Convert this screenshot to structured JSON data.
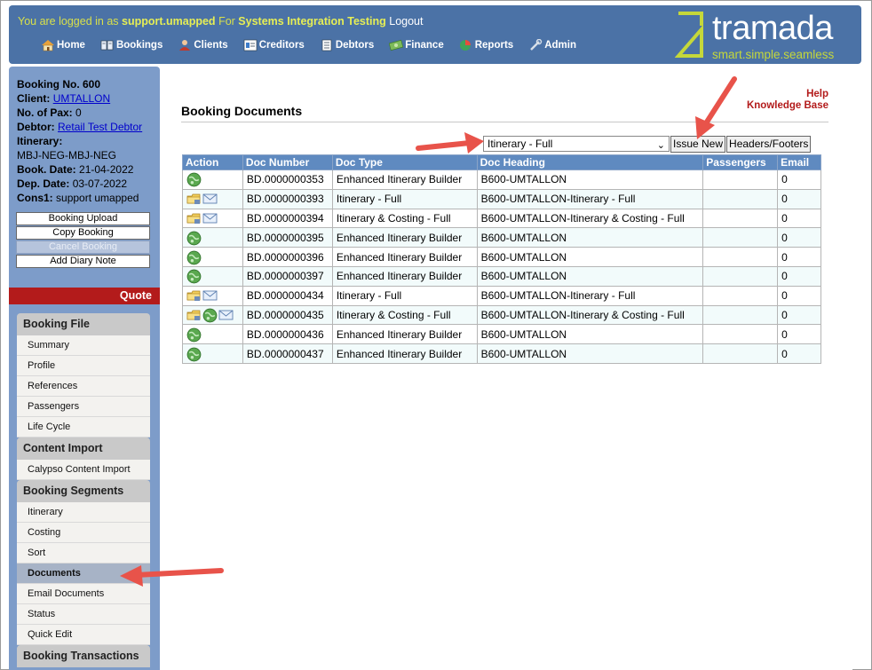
{
  "header": {
    "login_prefix": "You are logged in as",
    "username": "support.umapped",
    "for_text": "For",
    "system": "Systems Integration Testing",
    "logout": "Logout",
    "logo_name": "tramada",
    "logo_tagline": "smart.simple.seamless",
    "nav": [
      {
        "label": "Home",
        "icon": "home-icon"
      },
      {
        "label": "Bookings",
        "icon": "bookings-icon"
      },
      {
        "label": "Clients",
        "icon": "clients-icon"
      },
      {
        "label": "Creditors",
        "icon": "creditors-icon"
      },
      {
        "label": "Debtors",
        "icon": "debtors-icon"
      },
      {
        "label": "Finance",
        "icon": "finance-icon"
      },
      {
        "label": "Reports",
        "icon": "reports-icon"
      },
      {
        "label": "Admin",
        "icon": "admin-icon"
      }
    ]
  },
  "booking": {
    "number_label": "Booking No. 600",
    "client_label": "Client:",
    "client_value": "UMTALLON",
    "pax_label": "No. of Pax:",
    "pax_value": "0",
    "debtor_label": "Debtor:",
    "debtor_value": "Retail Test Debtor",
    "itinerary_label": "Itinerary:",
    "itinerary_value": "MBJ-NEG-MBJ-NEG",
    "book_date_label": "Book. Date:",
    "book_date_value": "21-04-2022",
    "dep_date_label": "Dep. Date:",
    "dep_date_value": "03-07-2022",
    "cons_label": "Cons1:",
    "cons_value": "support umapped"
  },
  "sidebar": {
    "buttons": {
      "upload": "Booking Upload",
      "copy": "Copy Booking",
      "cancel": "Cancel Booking",
      "diary": "Add Diary Note"
    },
    "quote": "Quote",
    "sections": {
      "file": "Booking File",
      "file_items": [
        "Summary",
        "Profile",
        "References",
        "Passengers",
        "Life Cycle"
      ],
      "content": "Content Import",
      "content_items": [
        "Calypso Content Import"
      ],
      "segments": "Booking Segments",
      "segment_items": [
        "Itinerary",
        "Costing",
        "Sort",
        "Documents",
        "Email Documents",
        "Status",
        "Quick Edit"
      ],
      "transactions": "Booking Transactions"
    }
  },
  "main": {
    "help": "Help",
    "kb": "Knowledge Base",
    "title": "Booking Documents",
    "select_value": "Itinerary - Full",
    "issue_new": "Issue New",
    "headers_footers": "Headers/Footers",
    "columns": [
      "Action",
      "Doc Number",
      "Doc Type",
      "Doc Heading",
      "Passengers",
      "Email"
    ],
    "rows": [
      {
        "icons": [
          "globe"
        ],
        "number": "BD.0000000353",
        "type": "Enhanced Itinerary Builder",
        "heading": "B600-UMTALLON",
        "passengers": "",
        "email": "0"
      },
      {
        "icons": [
          "folder",
          "mail"
        ],
        "number": "BD.0000000393",
        "type": "Itinerary - Full",
        "heading": "B600-UMTALLON-Itinerary - Full",
        "passengers": "",
        "email": "0"
      },
      {
        "icons": [
          "folder",
          "mail"
        ],
        "number": "BD.0000000394",
        "type": "Itinerary & Costing - Full",
        "heading": "B600-UMTALLON-Itinerary & Costing - Full",
        "passengers": "",
        "email": "0"
      },
      {
        "icons": [
          "globe"
        ],
        "number": "BD.0000000395",
        "type": "Enhanced Itinerary Builder",
        "heading": "B600-UMTALLON",
        "passengers": "",
        "email": "0"
      },
      {
        "icons": [
          "globe"
        ],
        "number": "BD.0000000396",
        "type": "Enhanced Itinerary Builder",
        "heading": "B600-UMTALLON",
        "passengers": "",
        "email": "0"
      },
      {
        "icons": [
          "globe"
        ],
        "number": "BD.0000000397",
        "type": "Enhanced Itinerary Builder",
        "heading": "B600-UMTALLON",
        "passengers": "",
        "email": "0"
      },
      {
        "icons": [
          "folder",
          "mail"
        ],
        "number": "BD.0000000434",
        "type": "Itinerary - Full",
        "heading": "B600-UMTALLON-Itinerary - Full",
        "passengers": "",
        "email": "0"
      },
      {
        "icons": [
          "folder",
          "globe",
          "mail"
        ],
        "number": "BD.0000000435",
        "type": "Itinerary & Costing - Full",
        "heading": "B600-UMTALLON-Itinerary & Costing - Full",
        "passengers": "",
        "email": "0"
      },
      {
        "icons": [
          "globe"
        ],
        "number": "BD.0000000436",
        "type": "Enhanced Itinerary Builder",
        "heading": "B600-UMTALLON",
        "passengers": "",
        "email": "0"
      },
      {
        "icons": [
          "globe"
        ],
        "number": "BD.0000000437",
        "type": "Enhanced Itinerary Builder",
        "heading": "B600-UMTALLON",
        "passengers": "",
        "email": "0"
      }
    ]
  },
  "colors": {
    "header_bg": "#4b72a6",
    "sidebar_bg": "#7d9cc9",
    "quote_bg": "#b31b1b",
    "table_header_bg": "#5f8ac0",
    "accent_yellow": "#d8e04a",
    "arrow": "#e8534a"
  }
}
